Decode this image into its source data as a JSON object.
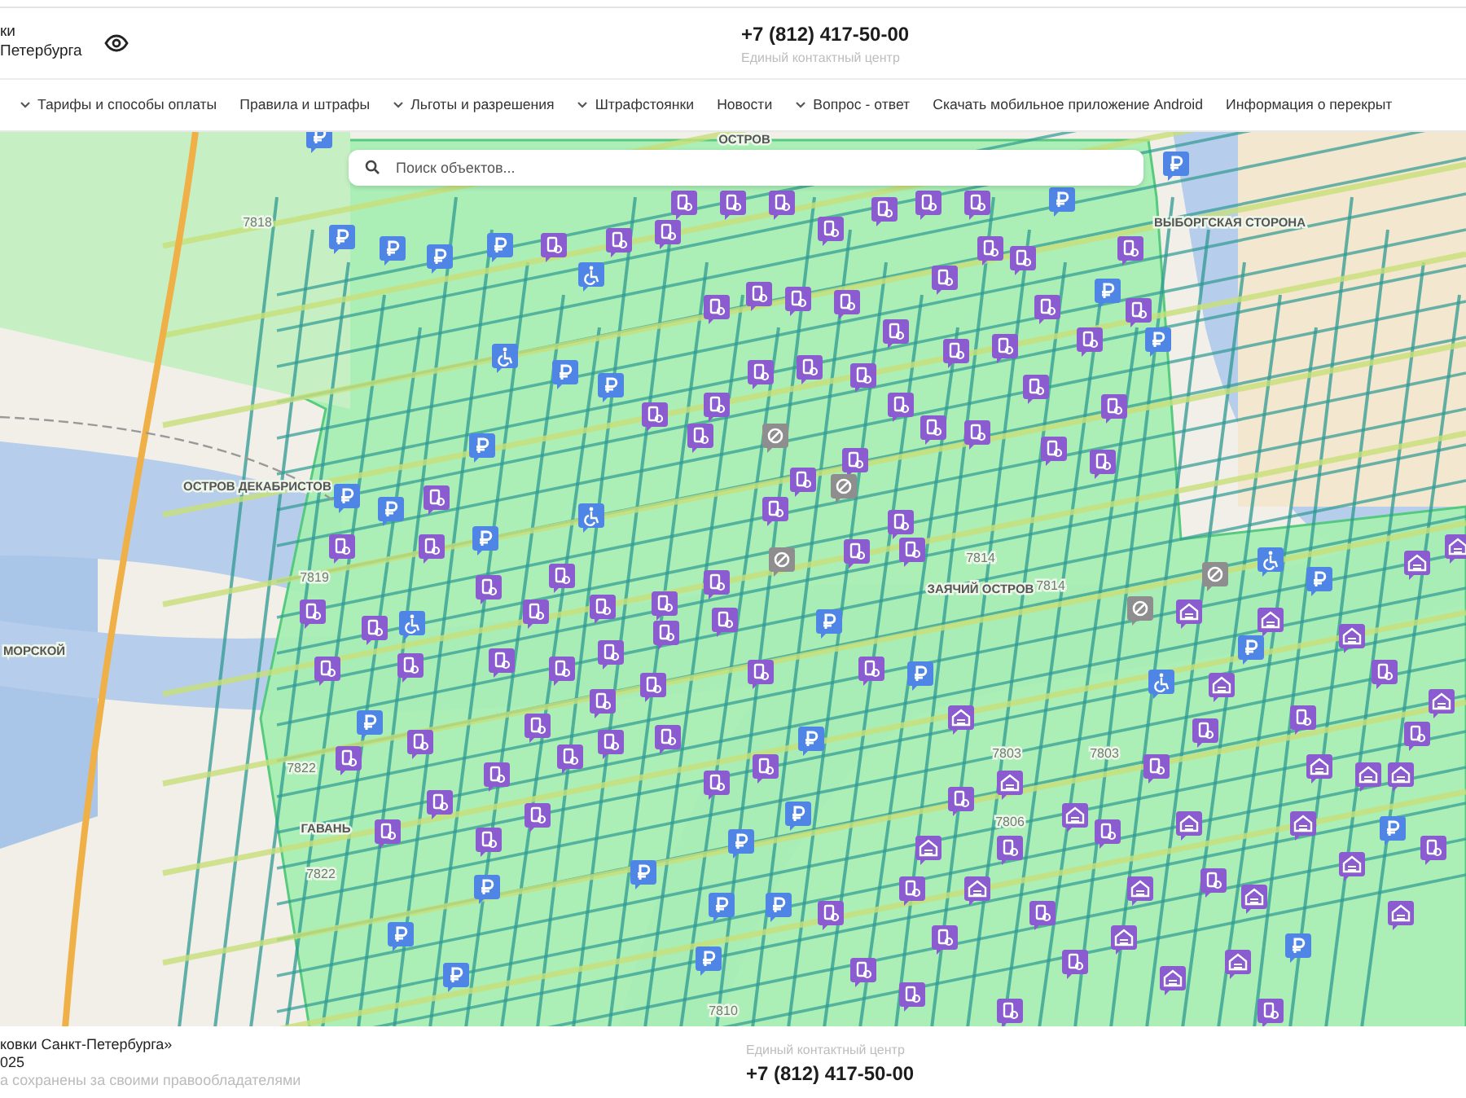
{
  "header": {
    "logo_lines": [
      "ки",
      "Петербурга"
    ],
    "phone": "+7 (812) 417-50-00",
    "phone_caption": "Единый контактный центр"
  },
  "nav": [
    {
      "label": "Тарифы и способы оплаты",
      "has_dropdown": true
    },
    {
      "label": "Правила и штрафы",
      "has_dropdown": false
    },
    {
      "label": "Льготы и разрешения",
      "has_dropdown": true
    },
    {
      "label": "Штрафстоянки",
      "has_dropdown": true
    },
    {
      "label": "Новости",
      "has_dropdown": false
    },
    {
      "label": "Вопрос - ответ",
      "has_dropdown": true
    },
    {
      "label": "Скачать мобильное приложение Android",
      "has_dropdown": false
    },
    {
      "label": "Информация о перекрыт",
      "has_dropdown": false
    }
  ],
  "search": {
    "placeholder": "Поиск объектов..."
  },
  "map": {
    "labels": [
      {
        "kind": "district",
        "text": "ОСТРОВ"
      },
      {
        "kind": "district",
        "text": "ВЫБОРГСКАЯ СТОРОНА"
      },
      {
        "kind": "district",
        "text": "ОСТРОВ ДЕКАБРИСТОВ"
      },
      {
        "kind": "district",
        "text": "МОРСКОЙ"
      },
      {
        "kind": "district",
        "text": "ЗАЯЧИЙ ОСТРОВ"
      },
      {
        "kind": "district",
        "text": "ГАВАНЬ"
      },
      {
        "kind": "zone",
        "text": "7818"
      },
      {
        "kind": "zone",
        "text": "7819"
      },
      {
        "kind": "zone",
        "text": "7822"
      },
      {
        "kind": "zone",
        "text": "7822"
      },
      {
        "kind": "zone",
        "text": "7814"
      },
      {
        "kind": "zone",
        "text": "7814"
      },
      {
        "kind": "zone",
        "text": "7803"
      },
      {
        "kind": "zone",
        "text": "7803"
      },
      {
        "kind": "zone",
        "text": "7806"
      },
      {
        "kind": "zone",
        "text": "7810"
      }
    ]
  },
  "footer": {
    "lines": [
      "ковки Санкт-Петербурга»",
      "025",
      "а сохранены за своими правообладателями"
    ],
    "phone_caption": "Единый контактный центр",
    "phone": "+7 (812) 417-50-00"
  }
}
